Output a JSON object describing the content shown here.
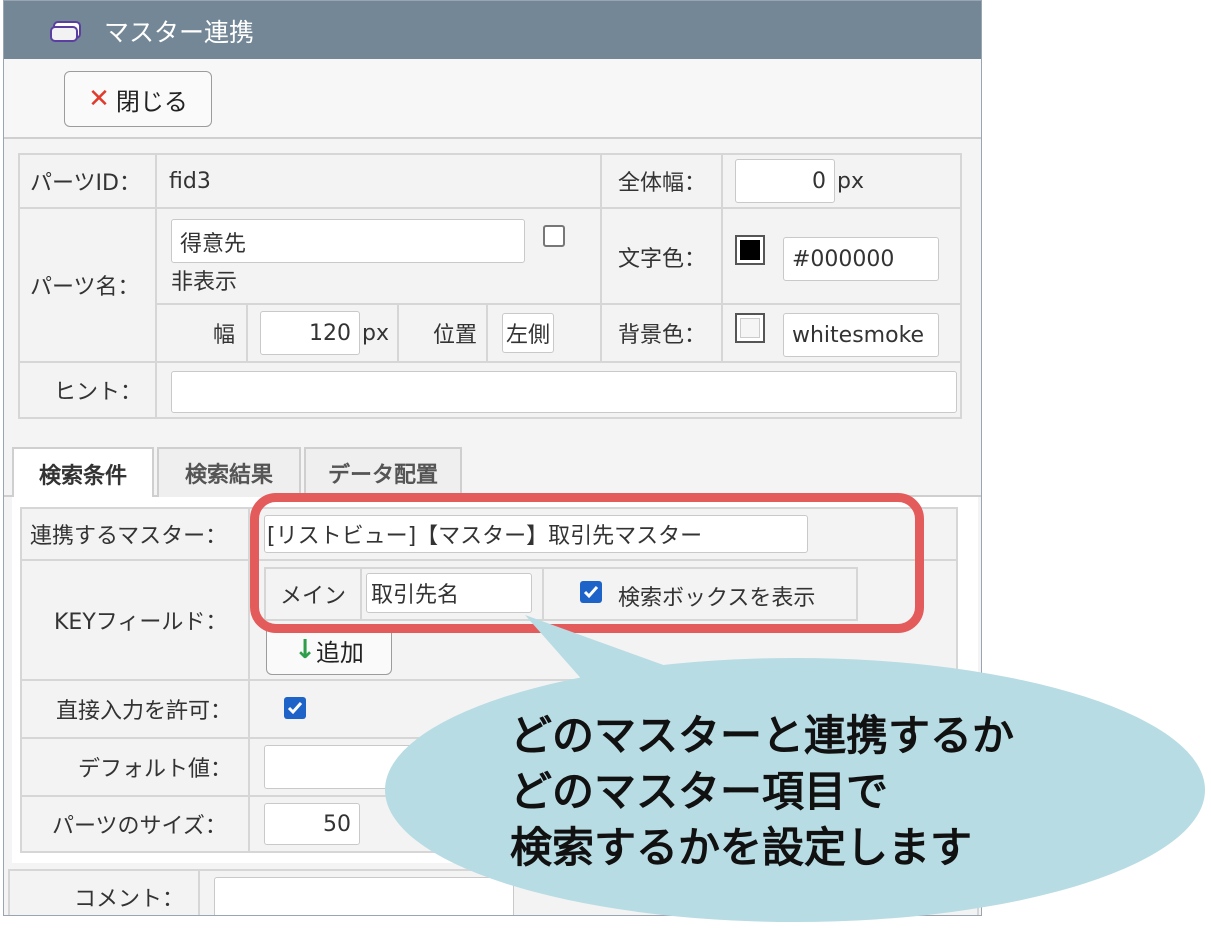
{
  "window": {
    "title": "マスター連携"
  },
  "toolbar": {
    "close_label": "閉じる"
  },
  "parts": {
    "id_label": "パーツID：",
    "id_value": "fid3",
    "total_width_label": "全体幅：",
    "total_width_value": "0",
    "px": "px",
    "name_label": "パーツ名：",
    "name_value": "得意先",
    "hidden_label": "非表示",
    "text_color_label": "文字色：",
    "text_color_value": "#000000",
    "width_label": "幅",
    "width_value": "120",
    "position_label": "位置",
    "position_value": "左側",
    "bg_color_label": "背景色：",
    "bg_color_value": "whitesmoke",
    "hint_label": "ヒント：",
    "hint_value": ""
  },
  "tabs": [
    {
      "label": "検索条件",
      "active": true
    },
    {
      "label": "検索結果",
      "active": false
    },
    {
      "label": "データ配置",
      "active": false
    }
  ],
  "search": {
    "master_label": "連携するマスター：",
    "master_value": "[リストビュー]【マスター】取引先マスター",
    "key_label": "KEYフィールド：",
    "main_label": "メイン",
    "key_value": "取引先名",
    "show_search_box_label": "検索ボックスを表示",
    "add_label": "追加",
    "direct_input_label": "直接入力を許可：",
    "default_label": "デフォルト値：",
    "default_value": "",
    "size_label": "パーツのサイズ：",
    "size_value": "50",
    "comment_label": "コメント："
  },
  "callout": {
    "line1": "どのマスターと連携するか",
    "line2": "どのマスター項目で",
    "line3": "検索するかを設定します"
  },
  "colors": {
    "titlebar": "#738796",
    "highlight": "#e45b5b",
    "bubble": "#b8dce3",
    "checkbox": "#1e64c8"
  }
}
